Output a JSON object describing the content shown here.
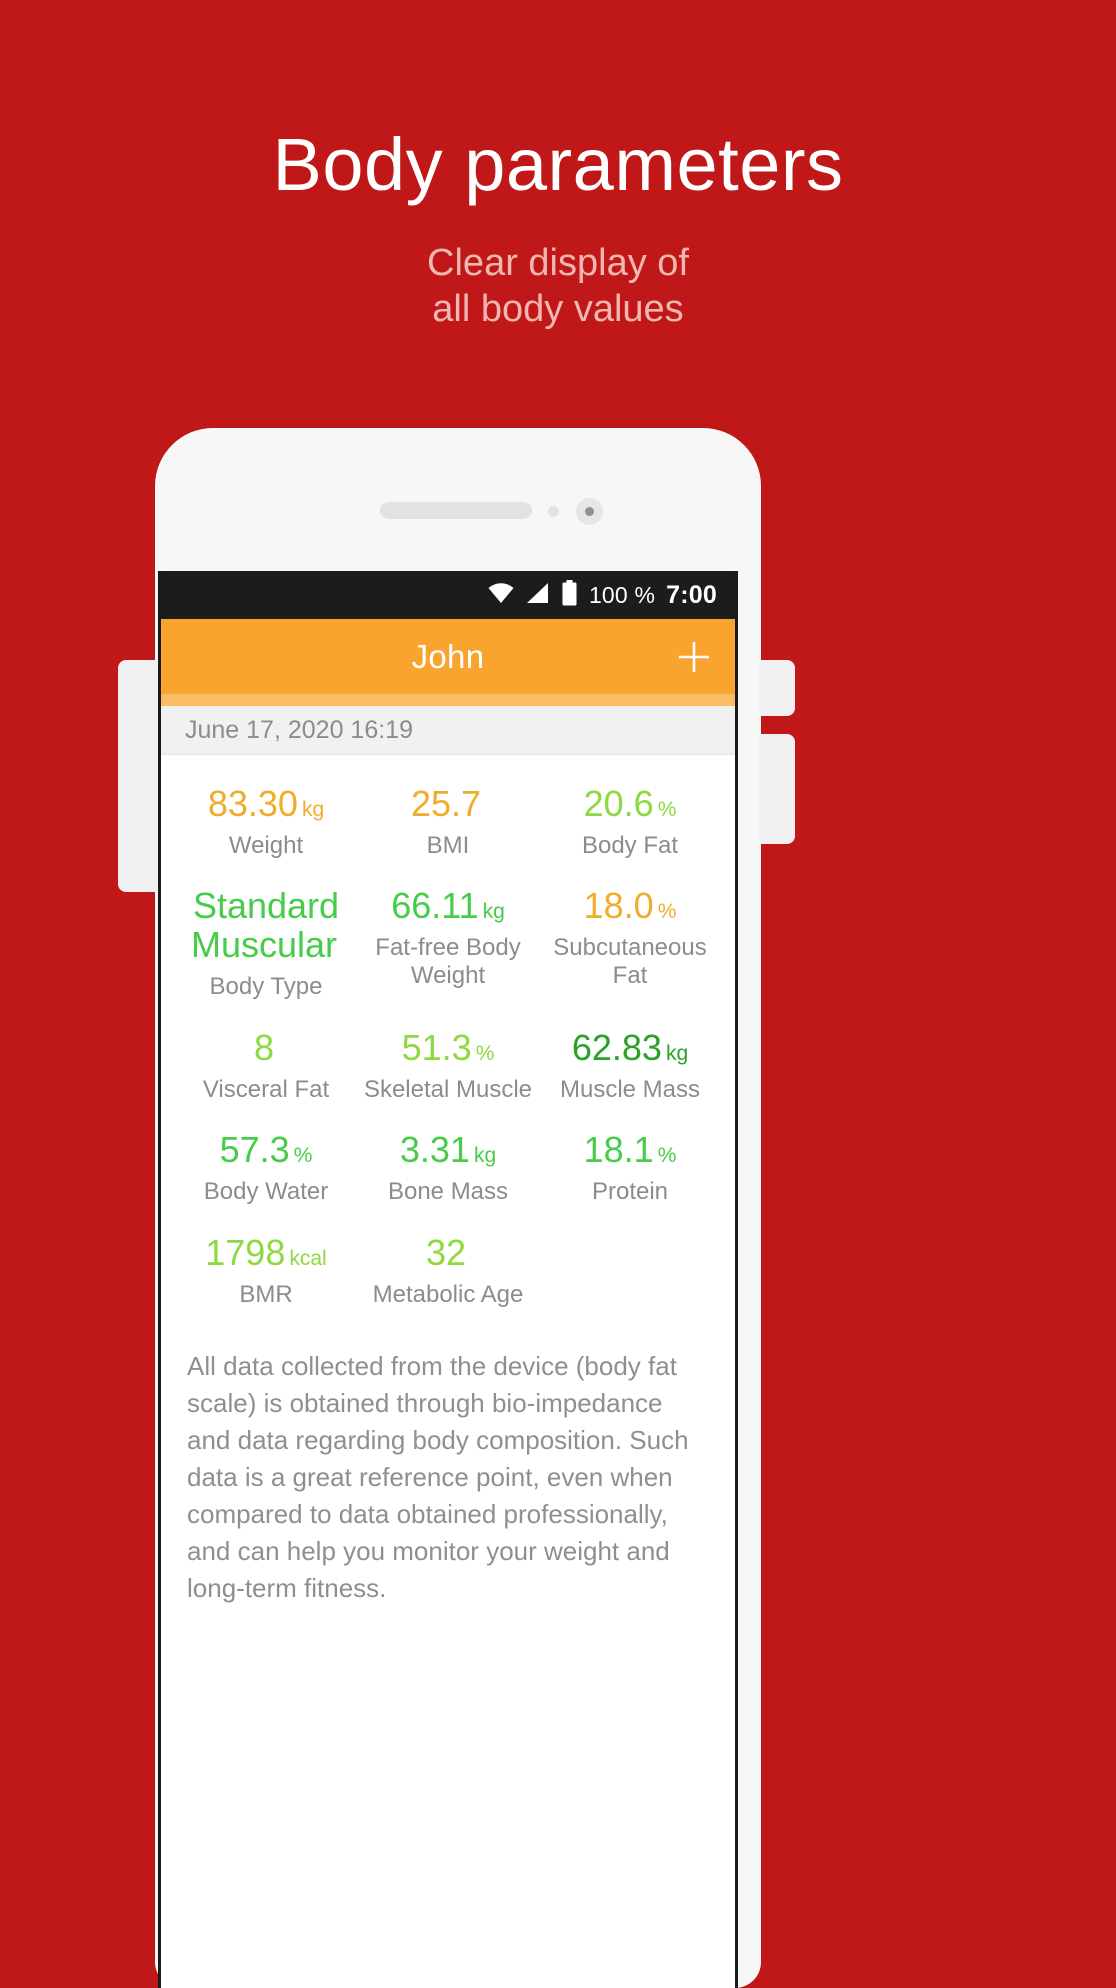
{
  "promo": {
    "title": "Body parameters",
    "subtitle_line1": "Clear display of",
    "subtitle_line2": "all body values",
    "title_color": "#ffffff",
    "subtitle_color": "#f2b6b0",
    "background_color": "#c01818"
  },
  "statusbar": {
    "wifi_icon": "wifi-icon",
    "signal_icon": "signal-icon",
    "battery_icon": "battery-icon",
    "battery_text": "100 %",
    "clock": "7:00"
  },
  "appbar": {
    "title": "John",
    "add_icon": "plus-icon",
    "background_color": "#f9a42e"
  },
  "daterow": {
    "date": "June 17, 2020 16:19"
  },
  "colors": {
    "orange": "#f0ac2b",
    "green_light": "#8dd93f",
    "green_mid": "#46cc48",
    "green_dark": "#2aa22a"
  },
  "metrics": [
    [
      {
        "value": "83.30",
        "unit": "kg",
        "label": "Weight",
        "color": "#f0ac2b"
      },
      {
        "value": "25.7",
        "unit": "",
        "label": "BMI",
        "color": "#f0ac2b"
      },
      {
        "value": "20.6",
        "unit": "%",
        "label": "Body Fat",
        "color": "#8dd93f"
      }
    ],
    [
      {
        "value": "Standard Muscular",
        "unit": "",
        "label": "Body Type",
        "color": "#46cc48"
      },
      {
        "value": "66.11",
        "unit": "kg",
        "label": "Fat-free Body Weight",
        "color": "#46cc48"
      },
      {
        "value": "18.0",
        "unit": "%",
        "label": "Subcutaneous Fat",
        "color": "#f0ac2b"
      }
    ],
    [
      {
        "value": "8",
        "unit": "",
        "label": "Visceral Fat",
        "color": "#8dd93f"
      },
      {
        "value": "51.3",
        "unit": "%",
        "label": "Skeletal Muscle",
        "color": "#8dd93f"
      },
      {
        "value": "62.83",
        "unit": "kg",
        "label": "Muscle Mass",
        "color": "#2aa22a"
      }
    ],
    [
      {
        "value": "57.3",
        "unit": "%",
        "label": "Body Water",
        "color": "#46cc48"
      },
      {
        "value": "3.31",
        "unit": "kg",
        "label": "Bone Mass",
        "color": "#46cc48"
      },
      {
        "value": "18.1",
        "unit": "%",
        "label": "Protein",
        "color": "#46cc48"
      }
    ],
    [
      {
        "value": "1798",
        "unit": "kcal",
        "label": "BMR",
        "color": "#8dd93f"
      },
      {
        "value": "32",
        "unit": "",
        "label": "Metabolic Age",
        "color": "#8dd93f"
      },
      {
        "value": "",
        "unit": "",
        "label": "",
        "color": "#8dd93f"
      }
    ]
  ],
  "description": "All data collected from the device (body fat scale) is obtained through bio-impedance and data regarding body composition. Such data is a great reference point, even when compared to data obtained professionally, and can help you monitor your weight and long-term fitness."
}
